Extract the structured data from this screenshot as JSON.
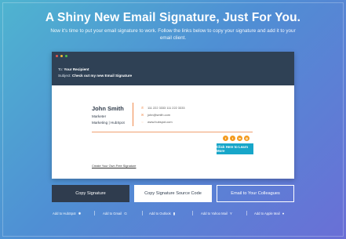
{
  "hero": {
    "title": "A Shiny New Email Signature, Just For You.",
    "subtitle": "Now it's time to put your email signature to work. Follow the links below to copy your signature and add it to your email client."
  },
  "email_window": {
    "dots": [
      "#e8584f",
      "#f3b735",
      "#4fc14a"
    ],
    "to_label": "To:",
    "to_value": "Your Recipient",
    "subject_label": "Subject:",
    "subject_value": "Check out my new Email Signature"
  },
  "signature": {
    "name": "John Smith",
    "title": "Marketer",
    "company": "Marketing | HubSpot",
    "phones": "111 222 3333    111 222 3333",
    "email": "john@smith.com",
    "website": "www.hubspot.com",
    "accent_color": "#f08a4b",
    "social_icons": [
      "facebook-icon",
      "twitter-icon",
      "linkedin-icon",
      "instagram-icon"
    ],
    "social_glyphs": [
      "f",
      "t",
      "in",
      "◎"
    ],
    "cta_label": "Click Here to Learn More",
    "create_link": "Create Your Own Free Signature"
  },
  "actions": {
    "copy_signature": "Copy Signature",
    "copy_source": "Copy Signature Source Code",
    "email_colleagues": "Email to Your Colleagues"
  },
  "add_links": [
    {
      "label": "Add to HubSpot",
      "icon": "hubspot-icon",
      "glyph": "✱"
    },
    {
      "label": "Add to Gmail",
      "icon": "gmail-icon",
      "glyph": "G"
    },
    {
      "label": "Add to Outlook",
      "icon": "outlook-icon",
      "glyph": "▮"
    },
    {
      "label": "Add to Yahoo Mail",
      "icon": "yahoo-icon",
      "glyph": "Y"
    },
    {
      "label": "Add to Apple Mail",
      "icon": "apple-icon",
      "glyph": "●"
    }
  ]
}
